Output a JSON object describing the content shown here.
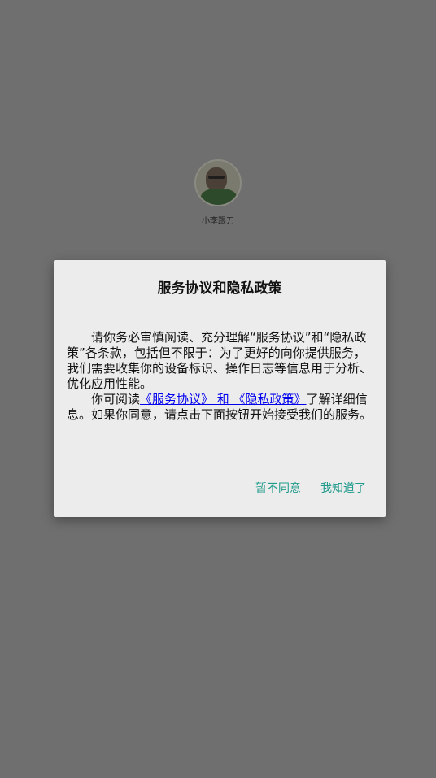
{
  "profile": {
    "name": "小李跟刀"
  },
  "dialog": {
    "title": "服务协议和隐私政策",
    "paragraph1": "请你务必审慎阅读、充分理解“服务协议”和“隐私政策”各条款，包括但不限于：为了更好的向你提供服务，我们需要收集你的设备标识、操作日志等信息用于分析、优化应用性能。",
    "paragraph2_prefix": "你可阅读",
    "paragraph2_link": "《服务协议》 和 《隐私政策》",
    "paragraph2_suffix": "了解详细信息。如果你同意，请点击下面按钮开始接受我们的服务。",
    "decline_label": "暂不同意",
    "accept_label": "我知道了"
  },
  "colors": {
    "backdrop": "#6f6f6f",
    "dialog_bg": "#ececec",
    "accent": "#1e9a8a",
    "link": "#0000ee"
  }
}
